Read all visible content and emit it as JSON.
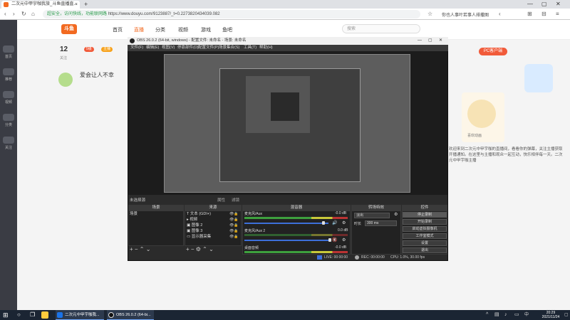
{
  "browser": {
    "tab_title": "二次元中甲宇咖我旅_斗鱼直播直...",
    "new_tab": "+",
    "security_text": "超安全，访问快线，功能联网路",
    "url": "https://www.douyu.com/9123887/_t=0.2273820434039.082",
    "toolbar_search": "你也人事叶若事人排撒图",
    "window_controls": [
      "—",
      "▢",
      "✕"
    ]
  },
  "site": {
    "logo": "斗鱼",
    "nav": [
      "首页",
      "直播",
      "分类",
      "视频",
      "游戏",
      "鱼吧"
    ],
    "active_nav": 1,
    "search_placeholder": "搜索",
    "side_items": [
      "首页",
      "推荐",
      "视频",
      "分类",
      "关注"
    ],
    "streamer_count": "12",
    "streamer_sub": "关注",
    "slogan": "爱会让人不幸",
    "badge_a": "5级",
    "badge_b": "主播",
    "right_button": "PC客户端",
    "right_caption": "喜欢动画",
    "right_text": "欢迎来到二次元中甲宇咖的直播间，看看你的弹幕，关注主播获取开播通知。在这里与主播和观众一起互动，快乐相伴每一天。二次元中甲宇咖主播"
  },
  "obs": {
    "title": "OBS 26.0.2 (64-bit, windows) - 配置文件: 未命名 - 场景: 未命名",
    "menu": [
      "文件(F)",
      "编辑(E)",
      "视图(V)",
      "停靠部件(D)",
      "配置文件(P)",
      "场景集合(S)",
      "工具(T)",
      "帮助(H)"
    ],
    "source_label": "未选择源",
    "properties": "属性",
    "filters": "滤镜",
    "docks": {
      "scenes": "场景",
      "sources": "来源",
      "mixer": "混音器",
      "transitions": "转场特效",
      "controls": "控件"
    },
    "scenes": [
      "场景"
    ],
    "sources": [
      "文本 (GDI+)",
      "视频",
      "图像 2",
      "图像 3",
      "显示器采集"
    ],
    "mixer": [
      {
        "name": "麦克风/Aux",
        "db": "-0.0 dB"
      },
      {
        "name": "麦克风/Aux 2",
        "db": "0.0 dB"
      },
      {
        "name": "桌面音频",
        "db": "-0.0 dB"
      }
    ],
    "transition": {
      "type": "淡出",
      "duration_label": "时长",
      "duration": "300 ms"
    },
    "controls": [
      "停止录制",
      "开始录制",
      "启动虚拟摄像机",
      "工作室模式",
      "设置",
      "退出"
    ],
    "status": {
      "live": "LIVE: 00:00:00",
      "rec": "REC: 00:00:00",
      "cpu": "CPU: 1.0%, 30.00 fps"
    }
  },
  "taskbar": {
    "apps": [
      "二次元中甲宇咖我...",
      "OBS 26.0.2 (64-bi..."
    ],
    "time": "20:29",
    "date": "2021/11/24",
    "ime": "中"
  }
}
